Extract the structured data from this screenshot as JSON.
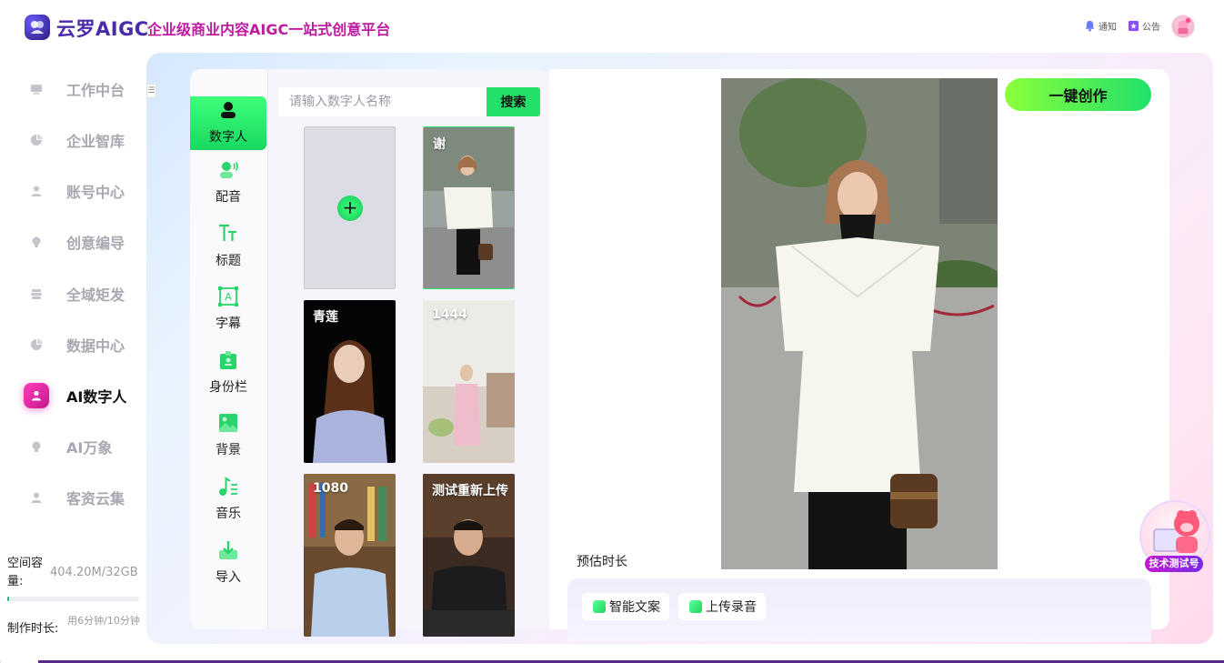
{
  "header": {
    "brand": "云罗AIGC",
    "slogan": "企业级商业内容AIGC一站式创意平台",
    "notify_label": "通知",
    "announce_label": "公告"
  },
  "sidebar": {
    "items": [
      {
        "label": "工作中台",
        "icon": "monitor-icon",
        "active": false
      },
      {
        "label": "企业智库",
        "icon": "pie-chart-icon",
        "active": false
      },
      {
        "label": "账号中心",
        "icon": "user-icon",
        "active": false
      },
      {
        "label": "创意编导",
        "icon": "bulb-icon",
        "active": false
      },
      {
        "label": "全域矩发",
        "icon": "stack-icon",
        "active": false
      },
      {
        "label": "数据中心",
        "icon": "pie-chart-icon",
        "active": false
      },
      {
        "label": "AI数字人",
        "icon": "digital-human-icon",
        "active": true
      },
      {
        "label": "AI万象",
        "icon": "bulb-icon",
        "active": false
      },
      {
        "label": "客资云集",
        "icon": "user-icon",
        "active": false
      }
    ],
    "storage_label": "空间容量:",
    "storage_value": "404.20M/32GB",
    "storage_fraction": 0.012,
    "time_label": "制作时长:",
    "time_value": "用6分钟/10分钟"
  },
  "tools": {
    "items": [
      {
        "label": "数字人",
        "icon": "digital-human-icon",
        "active": true
      },
      {
        "label": "配音",
        "icon": "voice-icon",
        "active": false
      },
      {
        "label": "标题",
        "icon": "title-text-icon",
        "active": false
      },
      {
        "label": "字幕",
        "icon": "subtitle-icon",
        "active": false
      },
      {
        "label": "身份栏",
        "icon": "id-badge-icon",
        "active": false
      },
      {
        "label": "背景",
        "icon": "image-icon",
        "active": false
      },
      {
        "label": "音乐",
        "icon": "music-icon",
        "active": false
      },
      {
        "label": "导入",
        "icon": "import-icon",
        "active": false
      }
    ]
  },
  "search": {
    "placeholder": "请输入数字人名称",
    "value": "",
    "button_label": "搜索"
  },
  "avatars": [
    {
      "name": "谢",
      "selected": true
    },
    {
      "name": "青莲",
      "selected": false
    },
    {
      "name": "1444",
      "selected": false
    },
    {
      "name": "1080",
      "selected": false
    },
    {
      "name": "测试重新上传",
      "selected": false
    }
  ],
  "preview": {
    "create_label": "一键创作",
    "duration_label": "预估时长",
    "smart_copy_label": "智能文案",
    "upload_audio_label": "上传录音"
  },
  "helper": {
    "tag": "技术测试号"
  },
  "colors": {
    "accent_green": "#22e06a",
    "active_nav": "#e6289f",
    "brand_purple": "#4a2aa8",
    "slogan_magenta": "#c01aa0"
  }
}
